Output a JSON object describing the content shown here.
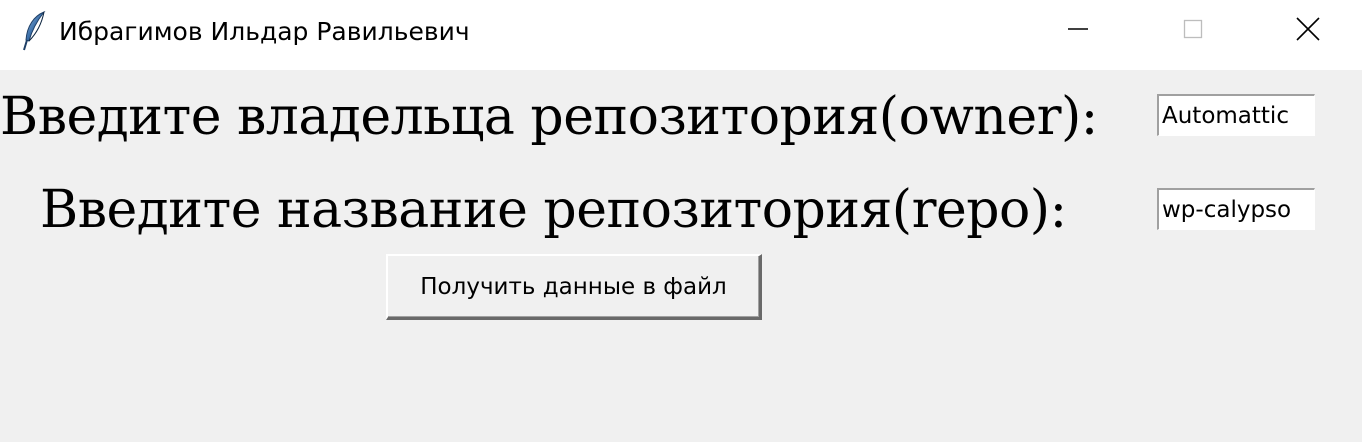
{
  "window": {
    "title": "Ибрагимов Ильдар Равильевич",
    "app_icon": "feather-icon",
    "controls": {
      "minimize_icon": "minimize-icon",
      "maximize_icon": "maximize-icon",
      "close_icon": "close-icon"
    }
  },
  "form": {
    "owner_label": "Введите владельца репозитория(owner):",
    "owner_value": "Automattic",
    "repo_label": "Введите название репозитория(repo):",
    "repo_value": "wp-calypso",
    "submit_label": "Получить данные в файл"
  },
  "colors": {
    "titlebar_bg": "#ffffff",
    "client_bg": "#f0f0f0",
    "entry_bg": "#ffffff",
    "text": "#000000"
  }
}
